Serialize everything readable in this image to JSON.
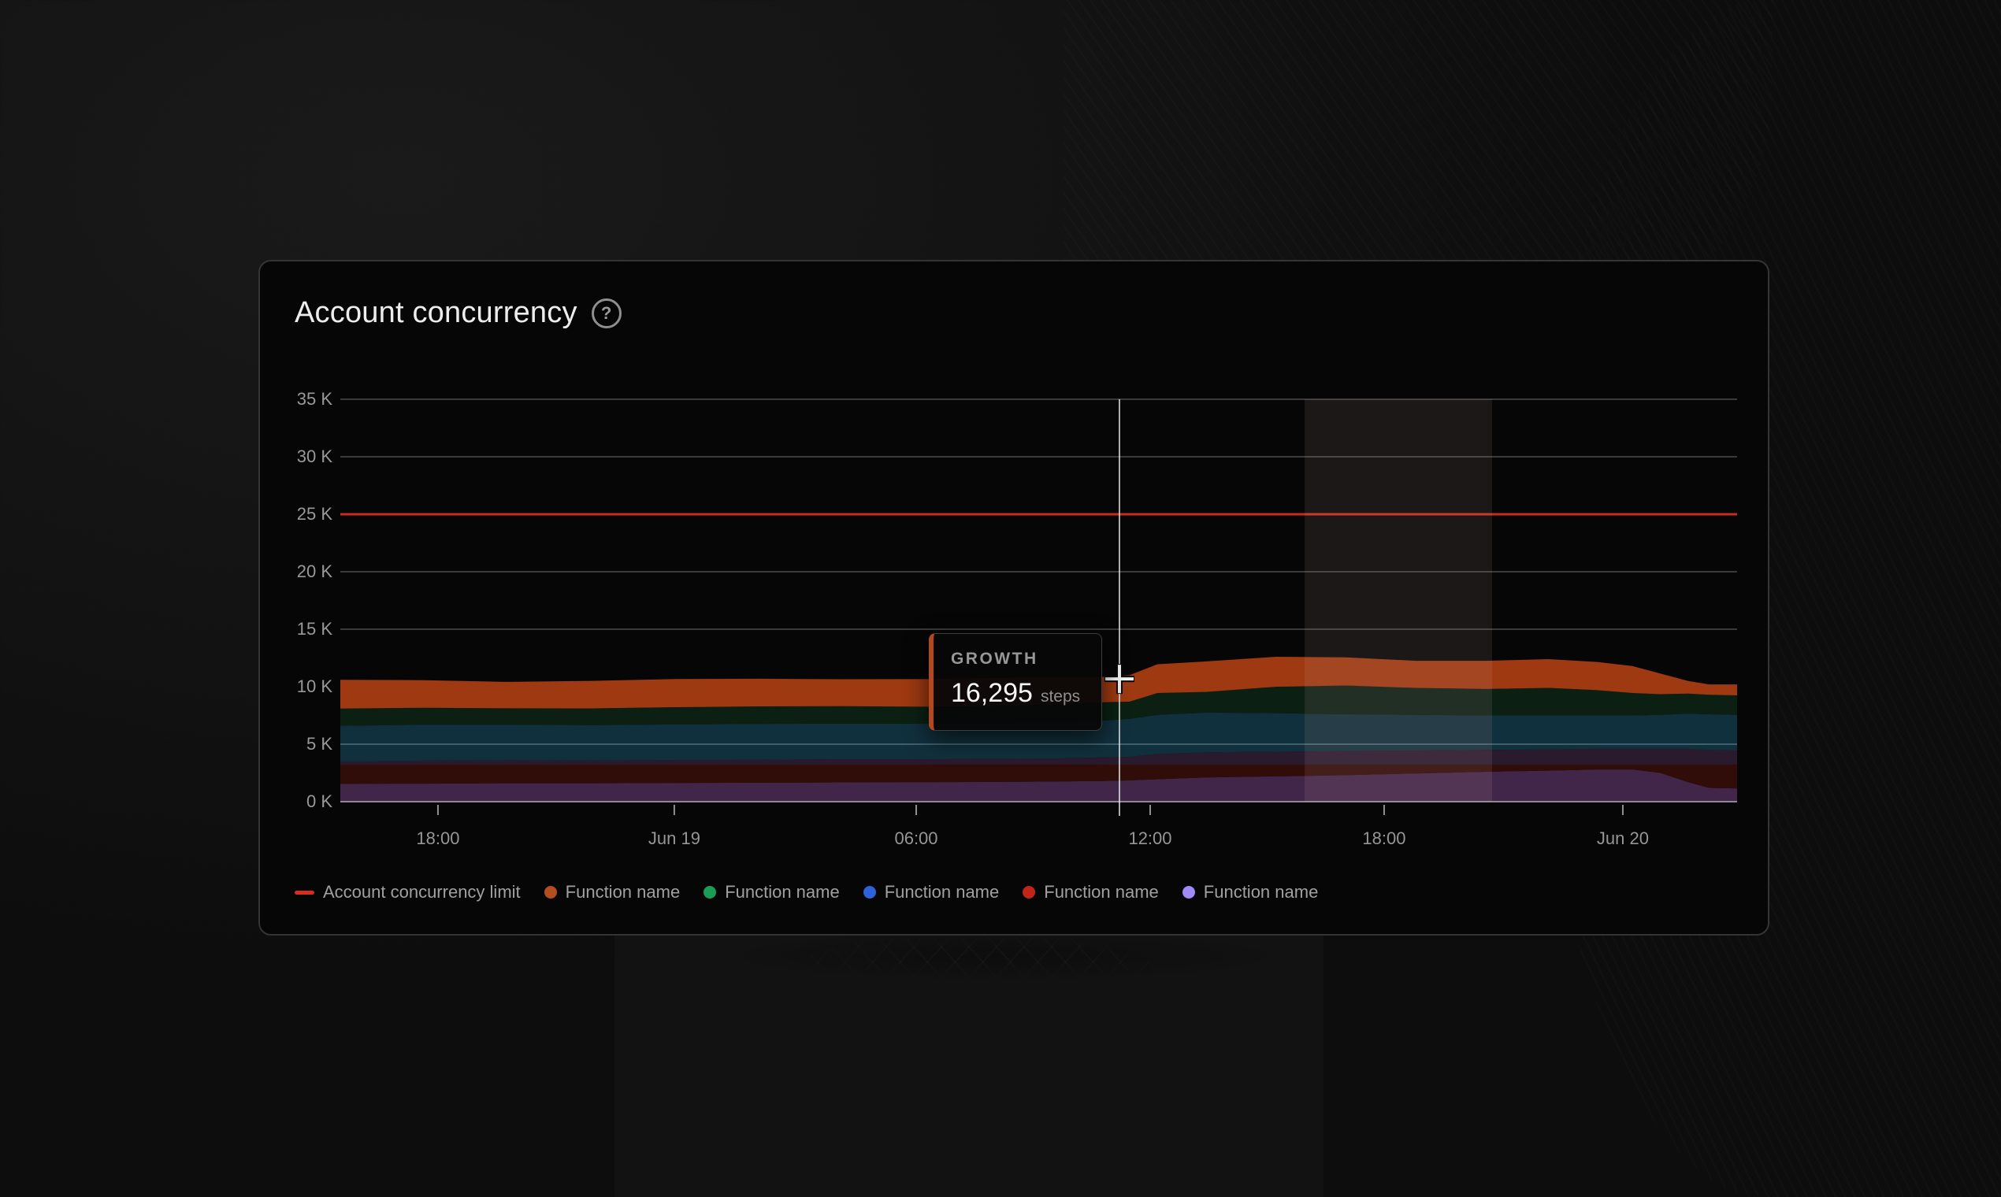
{
  "card": {
    "title": "Account concurrency",
    "help_icon": "?"
  },
  "chart_data": {
    "type": "area",
    "stacked": true,
    "title": "Account concurrency",
    "ylim": [
      0,
      35
    ],
    "grid": true,
    "yticks": [
      {
        "value": 0,
        "label": "0 K"
      },
      {
        "value": 5,
        "label": "5 K"
      },
      {
        "value": 10,
        "label": "10 K"
      },
      {
        "value": 15,
        "label": "15 K"
      },
      {
        "value": 20,
        "label": "20 K"
      },
      {
        "value": 25,
        "label": "25 K"
      },
      {
        "value": 30,
        "label": "30 K"
      },
      {
        "value": 35,
        "label": "35 K"
      }
    ],
    "xticks": [
      {
        "f": 0.0699,
        "label": "18:00"
      },
      {
        "f": 0.2391,
        "label": "Jun 19"
      },
      {
        "f": 0.4123,
        "label": "06:00"
      },
      {
        "f": 0.5798,
        "label": "12:00"
      },
      {
        "f": 0.7473,
        "label": "18:00"
      },
      {
        "f": 0.9182,
        "label": "Jun 20"
      }
    ],
    "limit_line": {
      "label": "Account concurrency limit",
      "value": 25,
      "color": "#cb2b1d"
    },
    "x_fractions": [
      0,
      0.06,
      0.12,
      0.18,
      0.24,
      0.3,
      0.36,
      0.42,
      0.47,
      0.51,
      0.545,
      0.565,
      0.585,
      0.62,
      0.67,
      0.72,
      0.77,
      0.82,
      0.865,
      0.9,
      0.925,
      0.945,
      0.965,
      0.98,
      1
    ],
    "series": [
      {
        "name": "Function name",
        "legend_color": "#a18af8",
        "fill": "#41264a",
        "values": [
          1.55,
          1.57,
          1.6,
          1.6,
          1.62,
          1.65,
          1.68,
          1.7,
          1.72,
          1.75,
          1.8,
          1.85,
          1.95,
          2.1,
          2.2,
          2.3,
          2.45,
          2.6,
          2.7,
          2.8,
          2.8,
          2.5,
          1.7,
          1.2,
          1.15
        ]
      },
      {
        "name": "Function name",
        "legend_color": "#c22418",
        "fill": "gradient",
        "fill_top": "#2a1a2e",
        "fill_bottom": "#300d08",
        "values": [
          1.95,
          2.0,
          2.0,
          1.98,
          2.0,
          2.0,
          2.02,
          2.0,
          2.0,
          2.0,
          2.05,
          2.05,
          2.2,
          2.2,
          2.15,
          2.1,
          2.0,
          1.9,
          1.85,
          1.8,
          1.8,
          2.1,
          2.9,
          3.3,
          3.3
        ]
      },
      {
        "name": "Function name",
        "legend_color": "#2e62d9",
        "fill": "#11303d",
        "values": [
          3.1,
          3.12,
          3.1,
          3.08,
          3.1,
          3.12,
          3.1,
          3.08,
          3.1,
          3.15,
          3.2,
          3.3,
          3.4,
          3.45,
          3.35,
          3.2,
          3.1,
          3.0,
          2.95,
          2.9,
          2.9,
          2.95,
          3.05,
          3.1,
          3.1
        ]
      },
      {
        "name": "Function name",
        "legend_color": "#1a9e55",
        "fill": "#0b2013",
        "values": [
          1.5,
          1.48,
          1.42,
          1.45,
          1.5,
          1.52,
          1.5,
          1.48,
          1.5,
          1.55,
          1.6,
          1.5,
          1.9,
          1.8,
          2.3,
          2.5,
          2.35,
          2.3,
          2.4,
          2.2,
          1.95,
          1.8,
          1.75,
          1.7,
          1.7
        ]
      },
      {
        "name": "Function name",
        "legend_color": "#b44d1f",
        "fill": "#9e3911",
        "values": [
          2.5,
          2.4,
          2.3,
          2.4,
          2.45,
          2.4,
          2.35,
          2.4,
          2.45,
          2.4,
          2.2,
          2.3,
          2.5,
          2.65,
          2.6,
          2.45,
          2.35,
          2.45,
          2.5,
          2.45,
          2.35,
          1.8,
          1.1,
          0.9,
          0.95
        ]
      }
    ],
    "highlight_band": {
      "from": 0.6904,
      "to": 0.8246
    },
    "crosshair": {
      "x": 0.5578,
      "cursor_y": 0.695
    },
    "tooltip": {
      "label": "GROWTH",
      "value": "16,295",
      "unit": "steps"
    },
    "legend": [
      {
        "type": "dash",
        "color": "#d92c1e",
        "label": "Account concurrency limit"
      },
      {
        "type": "dot",
        "color": "#b44d1f",
        "label": "Function name"
      },
      {
        "type": "dot",
        "color": "#1a9e55",
        "label": "Function name"
      },
      {
        "type": "dot",
        "color": "#2e62d9",
        "label": "Function name"
      },
      {
        "type": "dot",
        "color": "#c22418",
        "label": "Function name"
      },
      {
        "type": "dot",
        "color": "#a18af8",
        "label": "Function name"
      }
    ]
  }
}
